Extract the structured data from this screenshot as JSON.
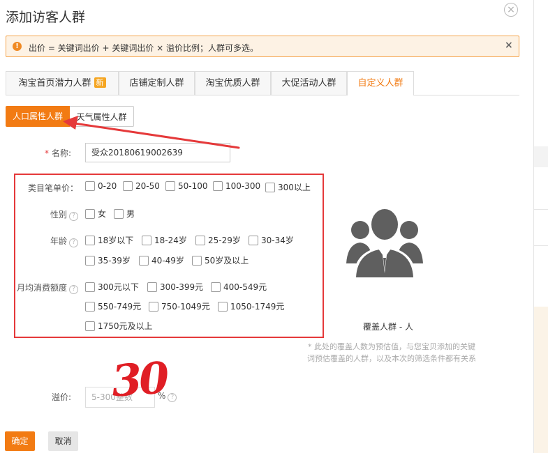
{
  "dialog": {
    "title": "添加访客人群",
    "close": "×"
  },
  "alert": {
    "text": "出价 = 关键词出价 + 关键词出价 × 溢价比例；人群可多选。",
    "close": "×",
    "icon": "!"
  },
  "tabs": [
    {
      "label": "淘宝首页潜力人群",
      "badge": "新"
    },
    {
      "label": "店铺定制人群"
    },
    {
      "label": "淘宝优质人群"
    },
    {
      "label": "大促活动人群"
    },
    {
      "label": "自定义人群",
      "active": true
    }
  ],
  "subtabs": {
    "active": "人口属性人群",
    "other": "天气属性人群"
  },
  "form": {
    "name_label": "名称:",
    "name_value": "受众20180619002639",
    "category_label": "类目笔单价：",
    "category_options": [
      "0-20",
      "20-50",
      "50-100",
      "100-300",
      "300以上"
    ],
    "gender_label": "性别",
    "gender_options": [
      "女",
      "男"
    ],
    "age_label": "年龄",
    "age_options": [
      "18岁以下",
      "18-24岁",
      "25-29岁",
      "30-34岁",
      "35-39岁",
      "40-49岁",
      "50岁及以上"
    ],
    "spend_label": "月均消费额度",
    "spend_options": [
      "300元以下",
      "300-399元",
      "400-549元",
      "550-749元",
      "750-1049元",
      "1050-1749元",
      "1750元及以上"
    ],
    "premium_label": "溢价:",
    "premium_placeholder": "5-300整数",
    "premium_unit": "%",
    "handwritten": "30"
  },
  "coverage": {
    "text": "覆盖人群 - 人",
    "note": "* 此处的覆盖人数为预估值，与您宝贝添加的关键词预估覆盖的人群，以及本次的筛选条件都有关系"
  },
  "buttons": {
    "ok": "确定",
    "cancel": "取消"
  },
  "colors": {
    "accent": "#f27b13",
    "annotation": "#e5393a"
  }
}
